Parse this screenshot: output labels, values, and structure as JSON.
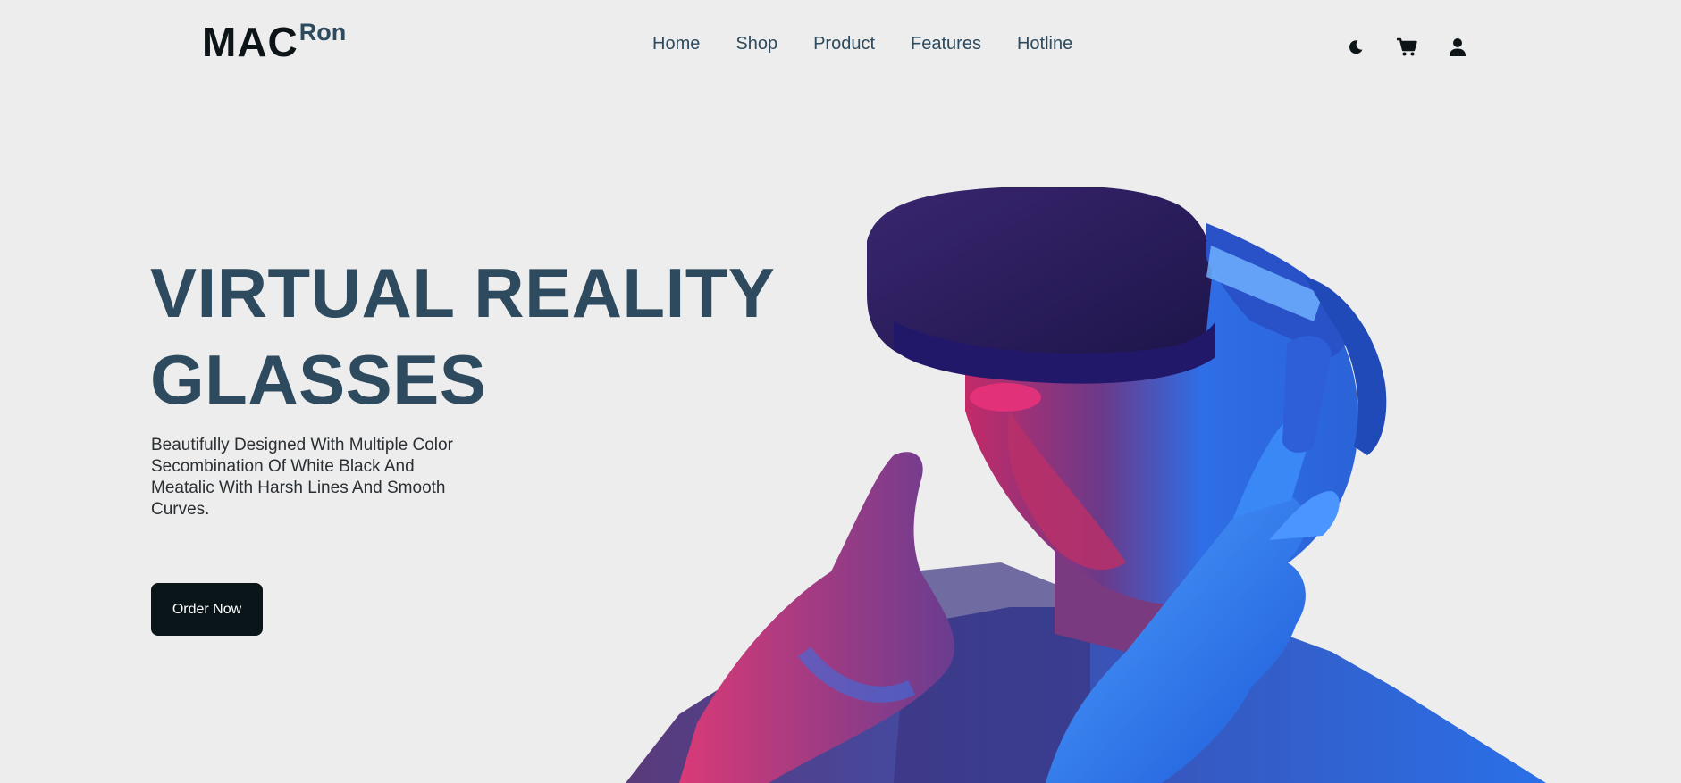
{
  "brand": {
    "main": "MAC",
    "sup": "Ron"
  },
  "nav": {
    "items": [
      {
        "label": "Home"
      },
      {
        "label": "Shop"
      },
      {
        "label": "Product"
      },
      {
        "label": "Features"
      },
      {
        "label": "Hotline"
      }
    ]
  },
  "header_icons": [
    "moon-icon",
    "cart-icon",
    "user-icon"
  ],
  "hero": {
    "title_line1": "VIRTUAL REALITY",
    "title_line2": "GLASSES",
    "description": "Beautifully Designed With Multiple Color Secombination Of White Black And Meatalic With Harsh Lines And Smooth Curves.",
    "cta_label": "Order Now"
  },
  "colors": {
    "background": "#ededed",
    "heading": "#2d4a5e",
    "logo": "#0d1417",
    "button": "#0a1519",
    "neon_pink": "#e8327a",
    "neon_blue": "#1f6ff0",
    "headset": "#2a1f5e"
  }
}
